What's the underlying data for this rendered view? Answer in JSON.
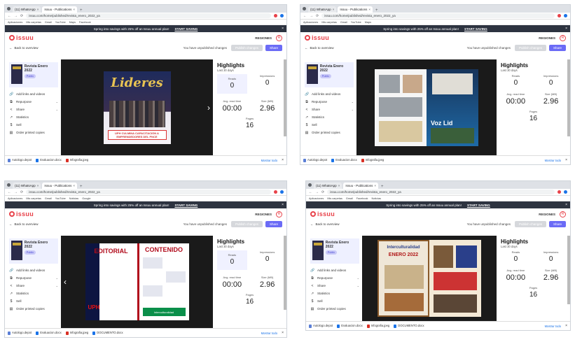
{
  "browser": {
    "tabs": [
      "(11) WhatsApp",
      "Issuu - Publications"
    ],
    "url": "issuu.com/home/published/revista_enero_2022_ya",
    "bookmarks": [
      "Aplicaciones",
      "Mis carpetas",
      "Gmail",
      "YouTube",
      "Maps",
      "Facebook",
      "Noticias",
      "Google"
    ]
  },
  "promo": {
    "text": "Spring into savings with 25% off an Issuu annual plan!",
    "cta": "START SAVING"
  },
  "issuu": {
    "logo": "issuu",
    "account": "REGIONES",
    "avatar_letter": "R",
    "back": "Back to overview",
    "unpublished": "You have unpublished changes",
    "publish": "Publish changes",
    "share": "Share"
  },
  "doc": {
    "title": "Revista Enero 2022",
    "badge": "Public"
  },
  "menu": [
    "Add links and videos",
    "Repurpose",
    "Share",
    "Statistics",
    "Sell",
    "Order printed copies"
  ],
  "highlights": {
    "title": "Highlights",
    "subtitle": "Last 30 days",
    "reads_label": "Reads",
    "reads": "0",
    "impressions_label": "Impressions",
    "impressions": "0",
    "avg_time_label": "Avg. read time",
    "avg_time": "00:00",
    "size_label": "Size (MB)",
    "size": "2.96",
    "pages_label": "Pages",
    "pages": "16"
  },
  "downloads": {
    "items": [
      "Autologo.depot",
      "Evaluacion.docx",
      "Infografia.jpeg",
      "Infografia.jpeg",
      "DOCUMENTO.docx"
    ],
    "show_all": "Mostrar todo"
  },
  "covers": {
    "p0_title": "Lideres",
    "p0_strip": "UPH CULMINA CAPACITACIÓN A EMPRENDEDORES DEL PNCE",
    "p1_text": "Voz Lid",
    "p2_left": "EDITORIAL",
    "p2_right": "CONTENIDO",
    "p2_banner": "Interculturalidad",
    "p2_uph": "UPH",
    "p3_title": "Interculturalidad",
    "p3_date": "ENERO 2022"
  },
  "colors": {
    "brand": "#e8424a",
    "share": "#6b6bf6",
    "promo": "#2d3340"
  }
}
